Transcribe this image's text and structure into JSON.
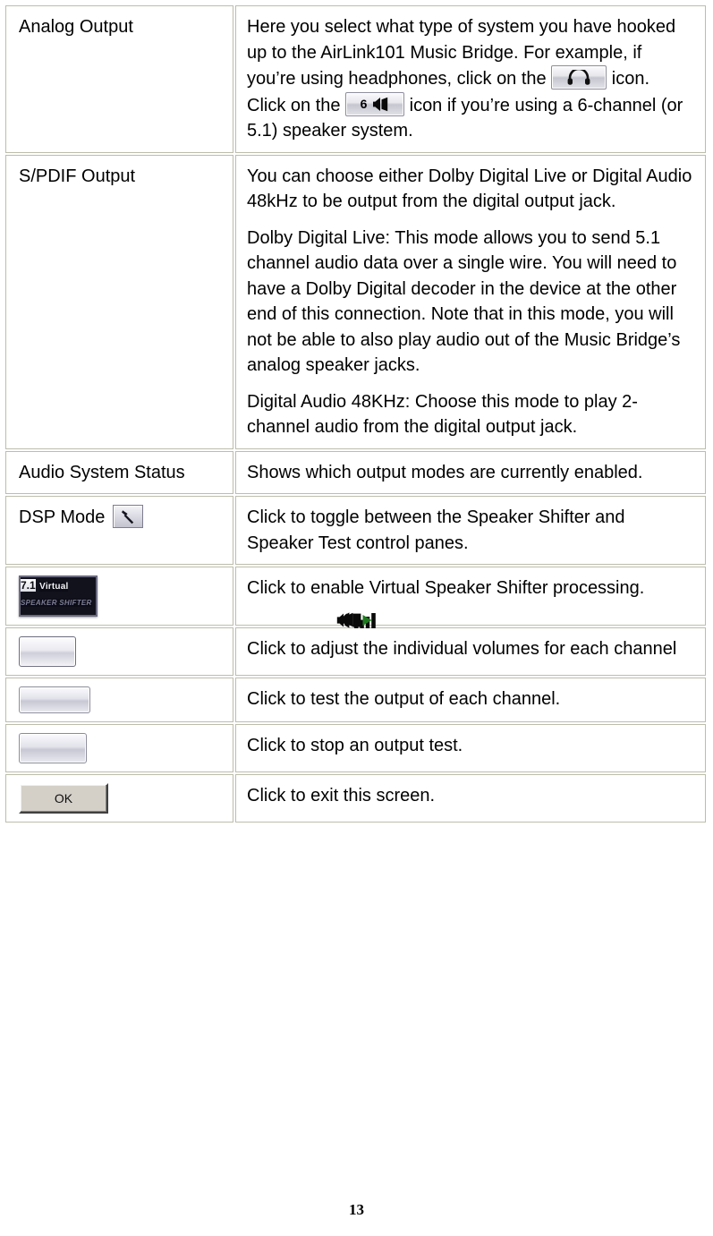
{
  "document": {
    "page_number": "13"
  },
  "table": {
    "rows": [
      {
        "id": "analog-output",
        "label": "Analog Output",
        "paragraphs": [
          {
            "segments": [
              {
                "type": "text",
                "value": "Here you select what type of system you have hooked up to the AirLink101 Music Bridge. For example, if you’re using headphones, click on the "
              },
              {
                "type": "icon",
                "name": "headphone-button-icon",
                "label": "headphones"
              },
              {
                "type": "text",
                "value": " icon. Click on the "
              },
              {
                "type": "icon",
                "name": "six-channel-speaker-button-icon",
                "label": "6",
                "glyph": "speaker"
              },
              {
                "type": "text",
                "value": " icon if you’re using a 6-channel (or 5.1) speaker system."
              }
            ]
          }
        ]
      },
      {
        "id": "spdif-output",
        "label": "S/PDIF Output",
        "paragraphs": [
          {
            "text": "You can choose either Dolby Digital Live or Digital Audio 48kHz to be output from the digital output jack."
          },
          {
            "text": "Dolby Digital Live: This mode allows you to send 5.1 channel audio data over a single wire. You will need to have a Dolby Digital decoder in the device at the other end of this connection. Note that in this mode, you will not be able to also play audio out of the Music Bridge’s analog speaker jacks."
          },
          {
            "text": "Digital Audio 48KHz: Choose this mode to play 2-channel audio from the digital output jack."
          }
        ]
      },
      {
        "id": "audio-system-status",
        "label": "Audio System Status",
        "paragraphs": [
          {
            "text": "Shows which output modes are currently enabled."
          }
        ]
      },
      {
        "id": "dsp-mode",
        "label": "DSP Mode",
        "has_label_icon": true,
        "label_icon": "hammer-tool-button-icon",
        "paragraphs": [
          {
            "text": "Click to toggle between the Speaker Shifter and Speaker Test control panes."
          }
        ]
      },
      {
        "id": "virtual-speaker-shifter",
        "label": "",
        "icon_only": true,
        "icon": "virtual-speaker-shifter-button-icon",
        "icon_text": {
          "line1": "7.1",
          "line2": "Virtual",
          "line3": "SPEAKER SHIFTER"
        },
        "paragraphs": [
          {
            "text": "Click to enable Virtual Speaker Shifter processing."
          }
        ]
      },
      {
        "id": "channel-volume",
        "label": "",
        "icon_only": true,
        "icon": "speaker-volume-bars-button-icon",
        "paragraphs": [
          {
            "text": "Click to adjust the individual volumes for each channel"
          }
        ]
      },
      {
        "id": "speaker-test-play",
        "label": "",
        "icon_only": true,
        "icon": "speaker-test-play-button-icon",
        "paragraphs": [
          {
            "text": "Click to test the output of each channel."
          }
        ]
      },
      {
        "id": "speaker-test-stop",
        "label": "",
        "icon_only": true,
        "icon": "stop-button-icon",
        "paragraphs": [
          {
            "text": "Click to stop an output test."
          }
        ]
      },
      {
        "id": "ok-exit",
        "label": "",
        "icon_only": true,
        "icon": "ok-button-icon",
        "icon_label": "OK",
        "paragraphs": [
          {
            "text": "Click to exit this screen."
          }
        ]
      }
    ]
  },
  "colors": {
    "border": "#bdbdac",
    "text": "#000000",
    "background": "#ffffff",
    "play_triangle": "#1f7a1f"
  }
}
